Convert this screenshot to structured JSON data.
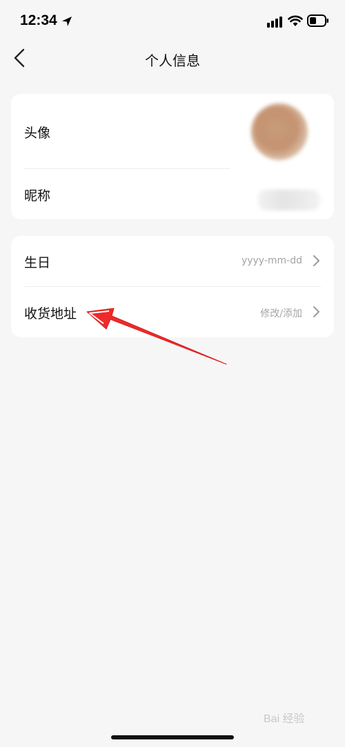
{
  "status_bar": {
    "time": "12:34",
    "icons": [
      "location-arrow-icon",
      "signal-icon",
      "wifi-icon",
      "battery-icon"
    ]
  },
  "nav": {
    "title": "个人信息",
    "back_icon": "chevron-left-icon"
  },
  "profile_card": {
    "avatar_label": "头像",
    "nickname_label": "昵称"
  },
  "info_card": {
    "birthday_label": "生日",
    "birthday_value": "yyyy-mm-dd",
    "address_label": "收货地址",
    "address_value": "修改/添加"
  },
  "watermark": "Bai 经验",
  "colors": {
    "background": "#f6f6f6",
    "card": "#ffffff",
    "annotation_arrow": "#ee2a2a"
  }
}
